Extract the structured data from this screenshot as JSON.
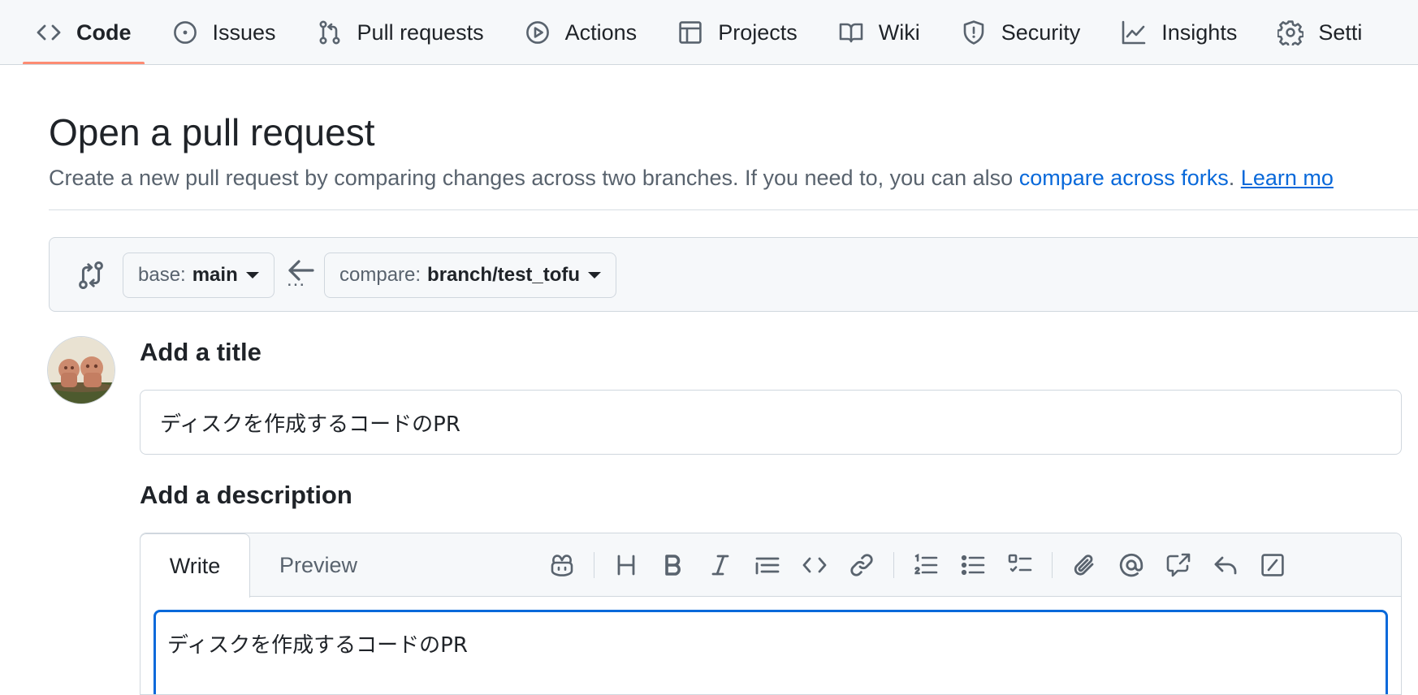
{
  "nav": {
    "tabs": [
      {
        "label": "Code",
        "icon": "code-icon",
        "selected": true
      },
      {
        "label": "Issues",
        "icon": "issue-opened-icon"
      },
      {
        "label": "Pull requests",
        "icon": "git-pull-request-icon"
      },
      {
        "label": "Actions",
        "icon": "play-icon"
      },
      {
        "label": "Projects",
        "icon": "table-icon"
      },
      {
        "label": "Wiki",
        "icon": "book-icon"
      },
      {
        "label": "Security",
        "icon": "shield-icon"
      },
      {
        "label": "Insights",
        "icon": "graph-icon"
      },
      {
        "label": "Setti",
        "icon": "gear-icon"
      }
    ],
    "accent": "#fd8c73"
  },
  "header": {
    "title": "Open a pull request",
    "subtitle_prefix": "Create a new pull request by comparing changes across two branches. If you need to, you can also ",
    "compare_forks_link": "compare across forks",
    "subtitle_suffix": ". ",
    "learn_more_link": "Learn mo"
  },
  "range": {
    "base_label": "base:",
    "base_branch": "main",
    "compare_label": "compare:",
    "compare_branch": "branch/test_tofu",
    "ellipsis": "..."
  },
  "form": {
    "title_label": "Add a title",
    "title_value": "ディスクを作成するコードのPR",
    "description_label": "Add a description",
    "write_tab": "Write",
    "preview_tab": "Preview",
    "body_value": "ディスクを作成するコードのPR"
  },
  "colors": {
    "link": "#0969da",
    "focus": "#0969da",
    "muted": "#59636e"
  }
}
